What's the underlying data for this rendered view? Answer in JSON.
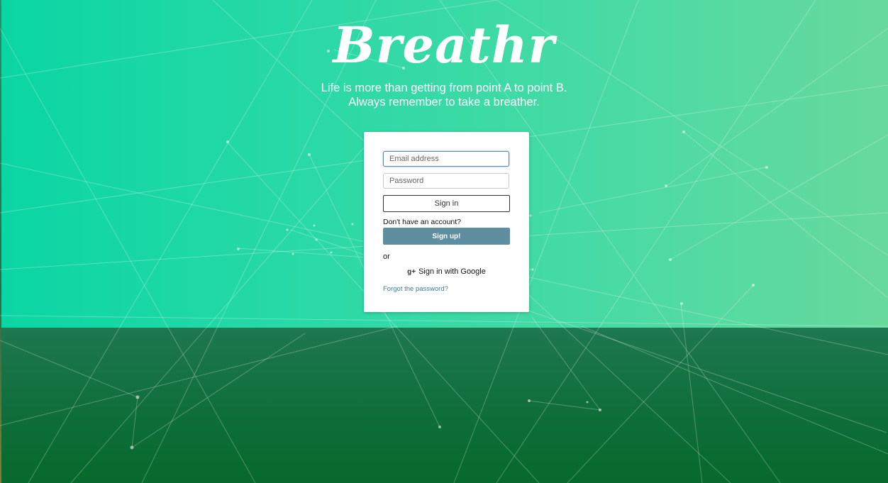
{
  "app": {
    "logo": "Breathr",
    "tagline_line1": "Life is more than getting from point A to point B.",
    "tagline_line2": "Always remember to take a breather."
  },
  "login": {
    "email_placeholder": "Email address",
    "password_placeholder": "Password",
    "signin_label": "Sign in",
    "no_account_text": "Don't have an account?",
    "signup_label": "Sign up!",
    "or_text": "or",
    "google_icon": "google-plus-icon",
    "google_label": "Sign in with Google",
    "forgot_label": "Forgot the password?"
  },
  "colors": {
    "accent_teal": "#0ad6a3",
    "accent_green": "#68d99d",
    "footer_green": "#07692c",
    "signup_button": "#5f8ea1",
    "link": "#3c7a9c"
  }
}
